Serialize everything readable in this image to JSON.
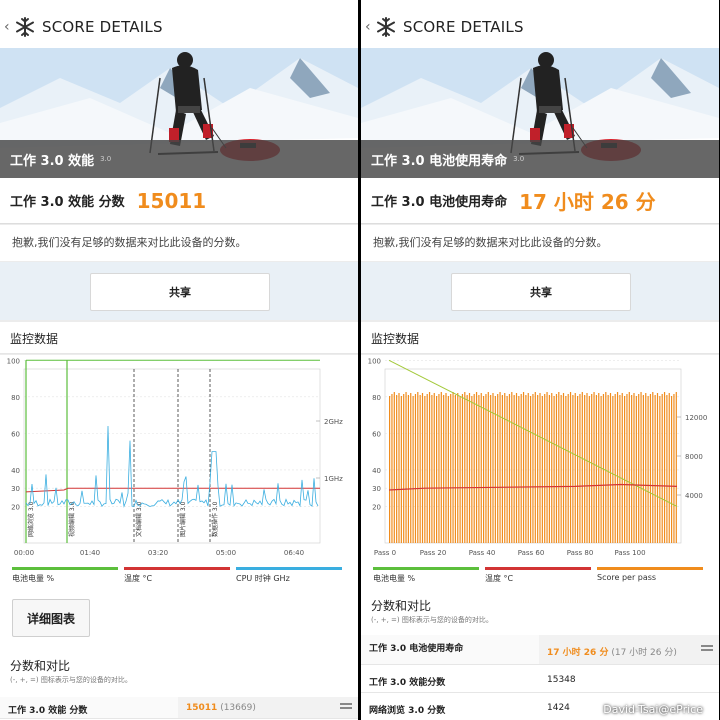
{
  "left": {
    "header": {
      "back_icon": "‹",
      "title": "SCORE DETAILS"
    },
    "hero": {
      "title": "工作 3.0 效能",
      "version": "3.0"
    },
    "score": {
      "label": "工作 3.0 效能 分数",
      "value": "15011"
    },
    "note": "抱歉,我们没有足够的数据来对比此设备的分数。",
    "share_label": "共享",
    "monitor_title": "监控数据",
    "chart_data": {
      "type": "line",
      "title": "",
      "x_ticks": [
        "00:00",
        "01:40",
        "03:20",
        "05:00",
        "06:40"
      ],
      "y_left_ticks": [
        "20",
        "40",
        "60",
        "80",
        "100"
      ],
      "y_left_extra_tick": "30",
      "y_right_ticks": [
        "1GHz",
        "2GHz"
      ],
      "phase_labels": [
        "网络浏览 3.0",
        "视频编辑 3.0",
        "文档编辑 3.0",
        "图片编辑 3.0",
        "数据操作 3.0"
      ],
      "series": [
        {
          "name": "电池电量 %",
          "color": "#5cbf3c",
          "values": [
            100,
            100,
            100,
            100,
            100
          ]
        },
        {
          "name": "温度 °C",
          "color": "#d23434",
          "values": [
            29,
            30,
            30,
            30,
            30
          ]
        },
        {
          "name": "CPU 时钟 GHz",
          "color": "#3aaee0",
          "values": [
            0.9,
            1.2,
            0.9,
            1.1,
            0.9
          ]
        }
      ]
    },
    "legend": [
      "电池电量 %",
      "温度 °C",
      "CPU 时钟 GHz"
    ],
    "detail_button": "详细图表",
    "compare_title": "分数和对比",
    "compare_sub": "(-, +, =) 图标表示与您的设备的对比。",
    "rows": [
      {
        "label": "工作 3.0 效能 分数",
        "value": "15011",
        "sub": "(13669)"
      }
    ]
  },
  "right": {
    "header": {
      "back_icon": "‹",
      "title": "SCORE DETAILS"
    },
    "hero": {
      "title": "工作 3.0 电池使用寿命",
      "version": "3.0"
    },
    "score": {
      "label": "工作 3.0 电池使用寿命",
      "value": "17 小时 26 分"
    },
    "note": "抱歉,我们没有足够的数据来对比此设备的分数。",
    "share_label": "共享",
    "monitor_title": "监控数据",
    "chart_data": {
      "type": "bar",
      "title": "",
      "x_ticks": [
        "Pass 0",
        "Pass 20",
        "Pass 40",
        "Pass 60",
        "Pass 80",
        "Pass 100"
      ],
      "y_left_ticks": [
        "20",
        "40",
        "60",
        "80",
        "100"
      ],
      "y_left_extra_tick": "30",
      "y_right_ticks": [
        "4000",
        "8000",
        "12000"
      ],
      "series": [
        {
          "name": "电池电量 %",
          "color": "#a3c93a",
          "values": [
            100,
            20
          ]
        },
        {
          "name": "温度 °C",
          "color": "#d23434",
          "values": [
            29,
            30,
            31,
            31,
            32,
            31
          ]
        },
        {
          "name": "Score per pass",
          "color": "#f08c1d",
          "value": 13600
        }
      ]
    },
    "legend": [
      "电池电量 %",
      "温度 °C",
      "Score per pass"
    ],
    "compare_title": "分数和对比",
    "compare_sub": "(-, +, =) 图标表示与您的设备的对比。",
    "rows": [
      {
        "label": "工作 3.0 电池使用寿命",
        "value": "17 小时 26 分",
        "sub": "(17 小时 26 分)"
      },
      {
        "label": "工作 3.0 效能分数",
        "value": "15348"
      },
      {
        "label": "网络浏览 3.0 分数",
        "value": "1424"
      }
    ],
    "watermark": "David-Tsai@ePrice"
  }
}
